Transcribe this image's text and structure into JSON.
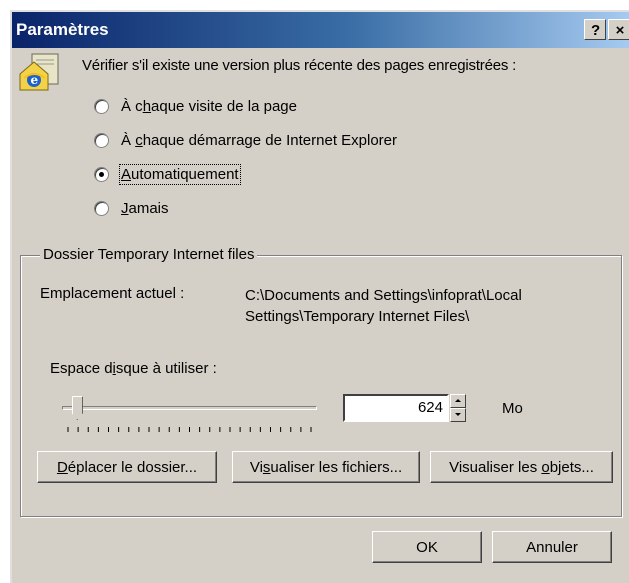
{
  "window": {
    "title": "Paramètres",
    "help_label": "?",
    "close_label": "×"
  },
  "check": {
    "header": "Vérifier s'il existe une version plus récente des pages enregistrées :",
    "options": [
      {
        "label_pre": "À c",
        "label_key": "h",
        "label_post": "aque visite de la page",
        "checked": false
      },
      {
        "label_pre": "À ",
        "label_key": "c",
        "label_post": "haque démarrage de Internet Explorer",
        "checked": false
      },
      {
        "label_pre": "",
        "label_key": "A",
        "label_post": "utomatiquement",
        "checked": true
      },
      {
        "label_pre": "",
        "label_key": "J",
        "label_post": "amais",
        "checked": false
      }
    ]
  },
  "temp_folder": {
    "group_title": "Dossier Temporary Internet files",
    "location_label": "Emplacement actuel :",
    "location_path_line1": "C:\\Documents and Settings\\infoprat\\Local",
    "location_path_line2": "Settings\\Temporary Internet Files\\",
    "disk_label_pre": "Espace d",
    "disk_label_key": "i",
    "disk_label_post": "sque à utiliser :",
    "slider_fraction": 0.04,
    "disk_value": "624",
    "unit": "Mo"
  },
  "buttons": {
    "move_pre": "",
    "move_key": "D",
    "move_post": "éplacer le dossier...",
    "files_pre": "Vi",
    "files_key": "s",
    "files_post": "ualiser les fichiers...",
    "objects_pre": "Visualiser les ",
    "objects_key": "o",
    "objects_post": "bjets...",
    "ok": "OK",
    "cancel": "Annuler"
  },
  "colors": {
    "face": "#d4d0c8",
    "title_start": "#0a246a",
    "title_end": "#a6caf0"
  }
}
